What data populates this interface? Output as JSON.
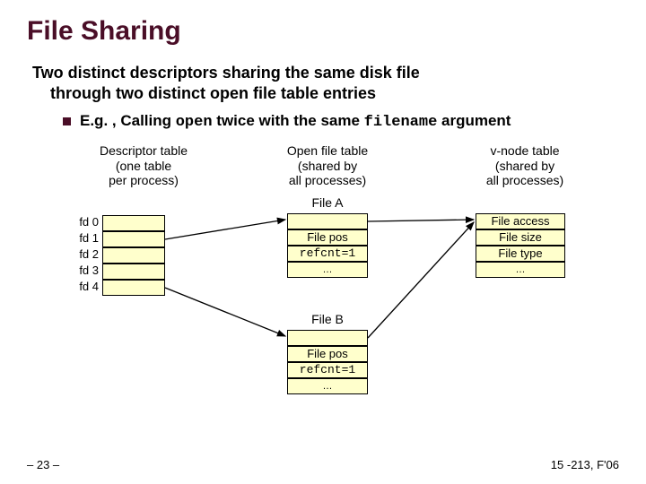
{
  "title": "File Sharing",
  "subtitle_line1": "Two distinct descriptors sharing the same disk file",
  "subtitle_line2": "through two distinct open file table entries",
  "bullet_prefix": "E.g. , Calling ",
  "bullet_code1": "open",
  "bullet_mid": " twice with the same ",
  "bullet_code2": "filename",
  "bullet_suffix": " argument",
  "cols": {
    "desc": {
      "l1": "Descriptor table",
      "l2": "(one table",
      "l3": "per process)"
    },
    "open": {
      "l1": "Open file table",
      "l2": "(shared by",
      "l3": "all processes)"
    },
    "vnode": {
      "l1": "v-node table",
      "l2": "(shared by",
      "l3": "all processes)"
    }
  },
  "fds": [
    "fd 0",
    "fd 1",
    "fd 2",
    "fd 3",
    "fd 4"
  ],
  "fileA": "File A",
  "fileB": "File B",
  "cells": {
    "filepos": "File pos",
    "refcnt": "refcnt=1",
    "ell": "…",
    "access": "File access",
    "size": "File size",
    "type": "File type"
  },
  "footer": {
    "left": "– 23 –",
    "right": "15 -213, F'06"
  }
}
